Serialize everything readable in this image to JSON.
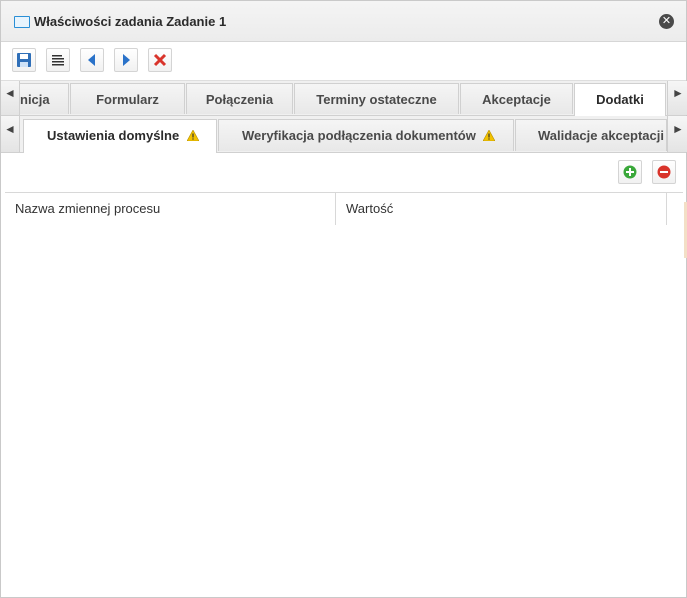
{
  "window": {
    "title": "Właściwości zadania Zadanie 1",
    "title_icon": "window-icon",
    "close_icon": "close-icon",
    "close_glyph": "✕"
  },
  "toolbar": {
    "buttons": [
      {
        "name": "save-button",
        "icon": "floppy-disk-icon"
      },
      {
        "name": "format-button",
        "icon": "text-lines-icon"
      },
      {
        "name": "previous-button",
        "icon": "arrow-left-icon"
      },
      {
        "name": "next-button",
        "icon": "arrow-right-icon"
      },
      {
        "name": "delete-button",
        "icon": "red-x-icon"
      }
    ]
  },
  "tabs": {
    "left_arrow": "◄",
    "right_arrow": "►",
    "items": [
      {
        "label": "nicja",
        "active": false
      },
      {
        "label": "Formularz",
        "active": false
      },
      {
        "label": "Połączenia",
        "active": false
      },
      {
        "label": "Terminy ostateczne",
        "active": false
      },
      {
        "label": "Akceptacje",
        "active": false
      },
      {
        "label": "Dodatki",
        "active": true
      }
    ]
  },
  "subtabs": {
    "left_arrow": "◄",
    "right_arrow": "►",
    "items": [
      {
        "label": "Ustawienia domyślne",
        "warning": true,
        "active": true
      },
      {
        "label": "Weryfikacja podłączenia dokumentów",
        "warning": true,
        "active": false
      },
      {
        "label": "Walidacje akceptacji",
        "warning": false,
        "active": false
      }
    ]
  },
  "grid": {
    "add_icon": "add-icon",
    "remove_icon": "remove-icon",
    "columns": [
      "Nazwa zmiennej procesu",
      "Wartość"
    ],
    "rows": []
  },
  "colors": {
    "accent_blue": "#2a8fd6",
    "add_green": "#3aa83a",
    "remove_red": "#d9342b",
    "warning_yellow": "#f2c200"
  }
}
